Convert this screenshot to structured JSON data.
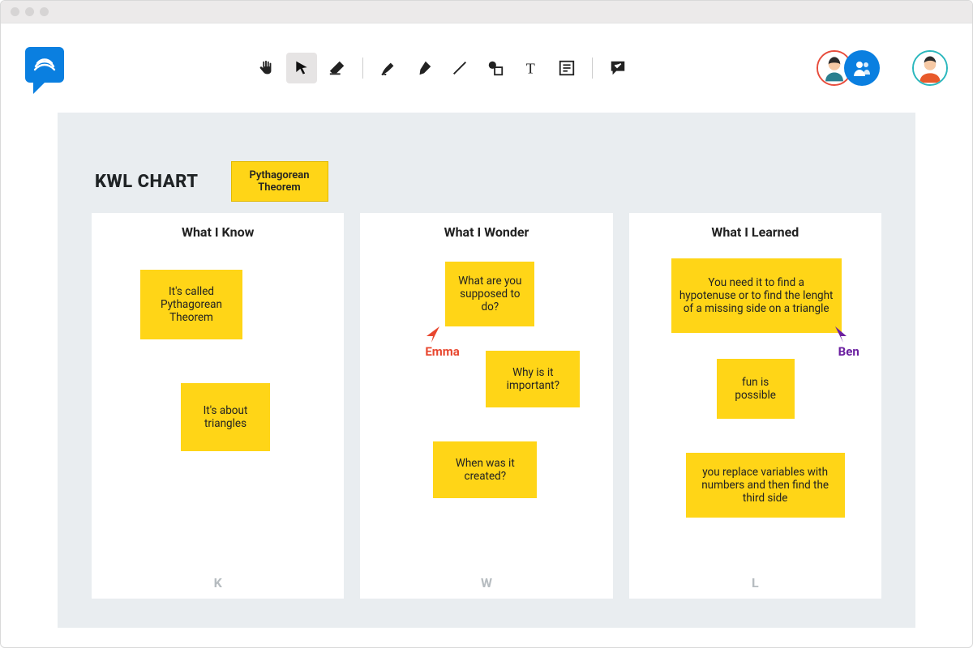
{
  "colors": {
    "brand_blue": "#0a7fe0",
    "sticky_yellow": "#ffd517",
    "canvas_bg": "#e9edf0",
    "emma_cursor": "#e8472f",
    "ben_cursor": "#6b1fa0"
  },
  "toolbar": {
    "tools": [
      {
        "name": "hand-icon",
        "active": false
      },
      {
        "name": "cursor-icon",
        "active": true
      },
      {
        "name": "eraser-icon",
        "active": false
      },
      {
        "name": "pen-icon",
        "active": false
      },
      {
        "name": "highlighter-icon",
        "active": false
      },
      {
        "name": "line-icon",
        "active": false
      },
      {
        "name": "shape-icon",
        "active": false
      },
      {
        "name": "text-icon",
        "active": false
      },
      {
        "name": "note-icon",
        "active": false
      },
      {
        "name": "comment-icon",
        "active": false
      }
    ]
  },
  "chart": {
    "title": "KWL CHART",
    "topic": "Pythagorean Theorem",
    "columns": [
      {
        "title": "What I Know",
        "letter": "K",
        "notes": [
          {
            "text": "It's called Pythagorean Theorem"
          },
          {
            "text": "It's about triangles"
          }
        ]
      },
      {
        "title": "What I Wonder",
        "letter": "W",
        "notes": [
          {
            "text": "What are you supposed to do?"
          },
          {
            "text": "Why is it important?"
          },
          {
            "text": "When was it created?"
          }
        ]
      },
      {
        "title": "What I Learned",
        "letter": "L",
        "notes": [
          {
            "text": "You need it to find a hypotenuse or to find the lenght of a missing side on a triangle"
          },
          {
            "text": "fun is possible"
          },
          {
            "text": "you replace variables with numbers and then find the third side"
          }
        ]
      }
    ]
  },
  "cursors": [
    {
      "label": "Emma",
      "color": "#e8472f"
    },
    {
      "label": "Ben",
      "color": "#6b1fa0"
    }
  ]
}
